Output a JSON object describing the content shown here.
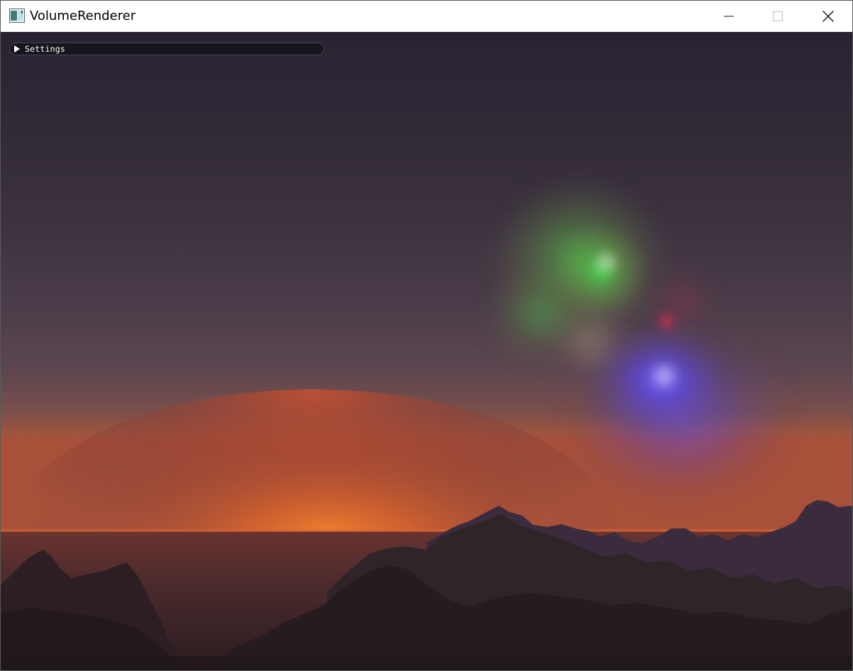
{
  "window": {
    "title": "VolumeRenderer",
    "icon": "app-window-icon",
    "controls": {
      "minimize_icon": "minimize-icon",
      "maximize_icon": "maximize-icon",
      "close_icon": "close-icon"
    }
  },
  "settings_panel": {
    "label": "Settings",
    "collapsed": true,
    "arrow_icon": "triangle-right-icon"
  },
  "scene": {
    "colors": {
      "sky_top": "#2b2430",
      "sky_mid": "#4a3c48",
      "horizon_glow": "#f5782e",
      "ground": "#241b1f",
      "cloud_green": "#3cd24a",
      "cloud_blue": "#5a46f0",
      "cloud_red": "#e02a48"
    }
  }
}
